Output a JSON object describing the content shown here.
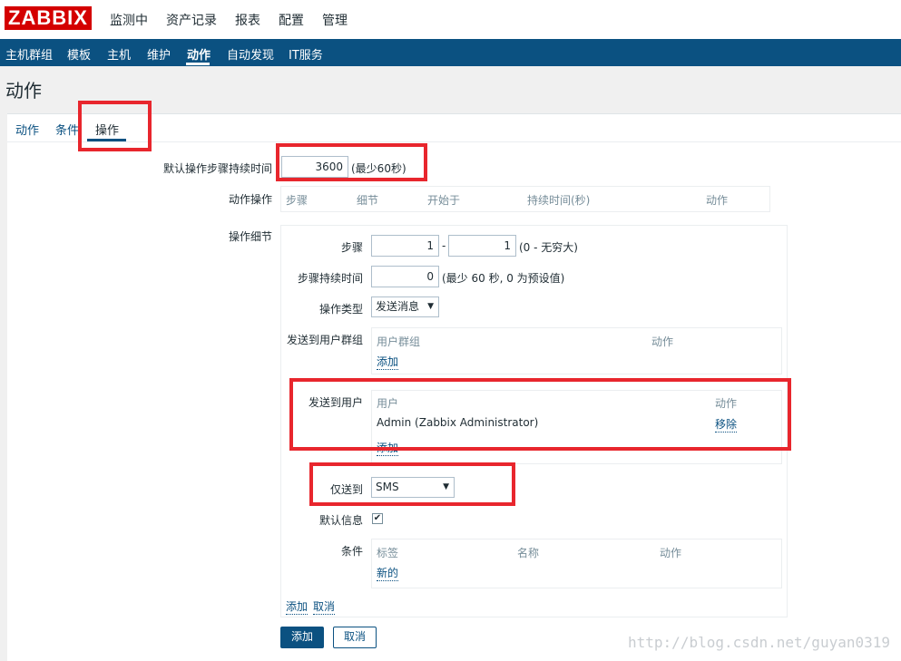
{
  "header": {
    "logo": "ZABBIX",
    "menu": [
      "监测中",
      "资产记录",
      "报表",
      "配置",
      "管理"
    ]
  },
  "subnav": {
    "items": [
      "主机群组",
      "模板",
      "主机",
      "维护",
      "动作",
      "自动发现",
      "IT服务"
    ],
    "active": "动作"
  },
  "page": {
    "title": "动作"
  },
  "tabs": [
    "动作",
    "条件",
    "操作"
  ],
  "form": {
    "default_step_duration_label": "默认操作步骤持续时间",
    "default_step_duration_value": "3600",
    "default_step_duration_hint": "(最少60秒)",
    "operations_label": "动作操作",
    "operations_columns": [
      "步骤",
      "细节",
      "开始于",
      "持续时间(秒)",
      "动作"
    ],
    "op_details_label": "操作细节",
    "details": {
      "steps_label": "步骤",
      "step_from": "1",
      "step_sep": "-",
      "step_to": "1",
      "steps_hint": "(0 - 无穷大)",
      "step_duration_label": "步骤持续时间",
      "step_duration_value": "0",
      "step_duration_hint": "(最少 60 秒, 0 为预设值)",
      "op_type_label": "操作类型",
      "op_type_value": "发送消息",
      "send_to_groups_label": "发送到用户群组",
      "groups_columns": [
        "用户群组",
        "动作"
      ],
      "groups_add": "添加",
      "send_to_users_label": "发送到用户",
      "users_columns": [
        "用户",
        "动作"
      ],
      "users_row": {
        "name": "Admin (Zabbix Administrator)",
        "action": "移除"
      },
      "users_add": "添加",
      "send_only_to_label": "仅送到",
      "send_only_to_value": "SMS",
      "default_message_label": "默认信息",
      "default_message_checked": true,
      "conditions_label": "条件",
      "conditions_columns": [
        "标签",
        "名称",
        "动作"
      ],
      "conditions_new": "新的",
      "footer_add": "添加",
      "footer_cancel": "取消"
    },
    "buttons": {
      "add": "添加",
      "cancel": "取消"
    }
  },
  "watermark": "http://blog.csdn.net/guyan0319",
  "colors": {
    "brand": "#d40000",
    "nav": "#0b5181",
    "highlight": "#e8262d"
  }
}
